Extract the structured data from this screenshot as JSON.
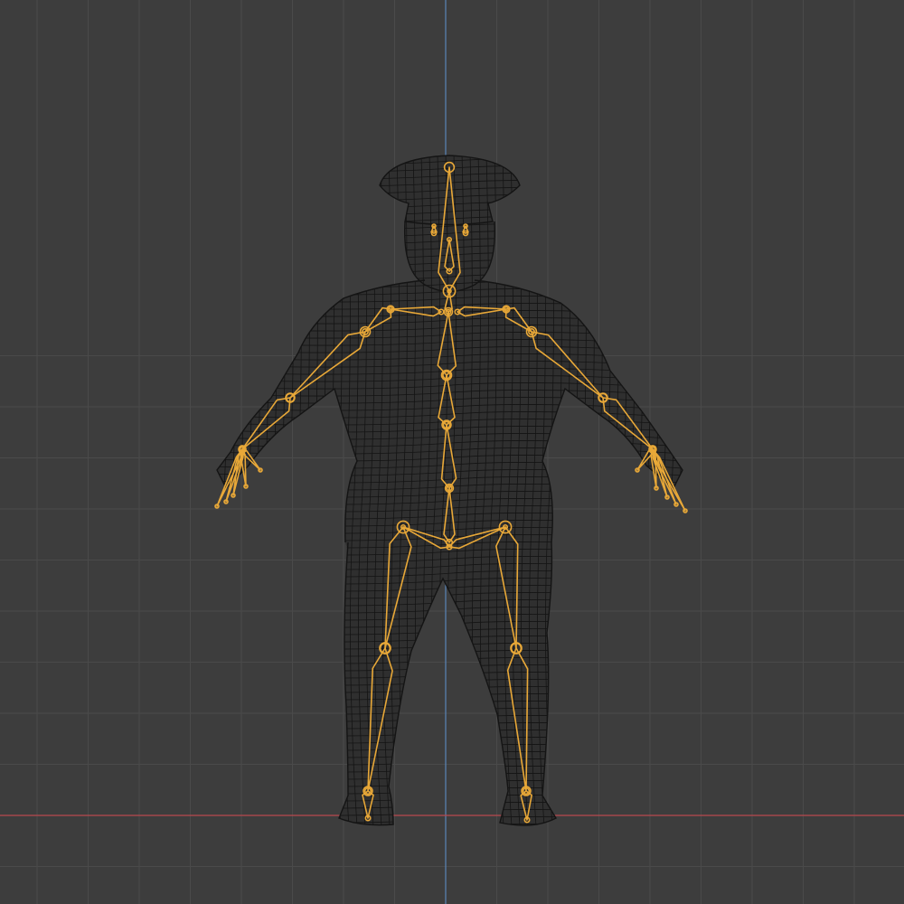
{
  "viewport": {
    "kind": "3d-viewport",
    "view": "front-orthographic",
    "shading": "wireframe",
    "grid": true,
    "colors": {
      "background": "#3d3d3d",
      "grid_minor": "#4a4a4a",
      "grid_major": "#555555",
      "axis_z": "#5b86b8",
      "axis_x": "#b8494f",
      "mesh_wire": "#141414",
      "armature": "#e8a838",
      "armature_dark": "#b5801f"
    }
  },
  "scene": {
    "mesh": {
      "icon": "mesh-icon",
      "subject": "uniformed-officer-character"
    },
    "armature": {
      "icon": "armature-icon",
      "state": "selected"
    }
  }
}
